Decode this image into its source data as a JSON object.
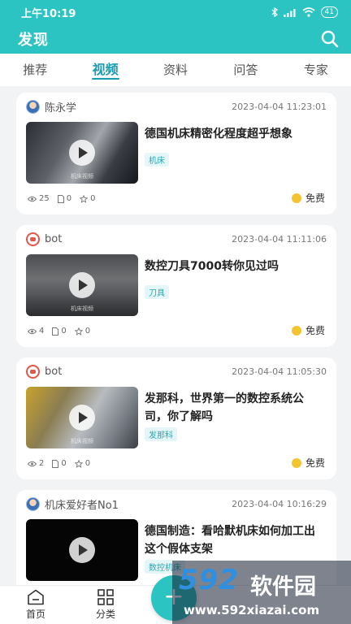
{
  "status": {
    "time": "上午10:19",
    "battery": "41"
  },
  "header": {
    "title": "发现"
  },
  "tabs": [
    {
      "label": "推荐"
    },
    {
      "label": "视频"
    },
    {
      "label": "资料"
    },
    {
      "label": "问答"
    },
    {
      "label": "专家"
    }
  ],
  "active_tab": "视频",
  "cards": [
    {
      "author": "陈永学",
      "time": "2023-04-04 11:23:01",
      "title": "德国机床精密化程度超乎想象",
      "tag": "机床",
      "views": "25",
      "docs": "0",
      "stars": "0",
      "price": "免费",
      "thumb_caption": "机床视频"
    },
    {
      "author": "bot",
      "time": "2023-04-04 11:11:06",
      "title": "数控刀具7000转你见过吗",
      "tag": "刀具",
      "views": "4",
      "docs": "0",
      "stars": "0",
      "price": "免费",
      "thumb_caption": "机床视频"
    },
    {
      "author": "bot",
      "time": "2023-04-04 11:05:30",
      "title": "发那科，世界第一的数控系统公司，你了解吗",
      "tag": "发那科",
      "views": "2",
      "docs": "0",
      "stars": "0",
      "price": "免费",
      "thumb_caption": "机床视频"
    },
    {
      "author": "机床爱好者No1",
      "time": "2023-04-04 10:16:29",
      "title": "德国制造：看哈默机床如何加工出这个假体支架",
      "tag": "数控机床"
    }
  ],
  "bottom_nav": {
    "home_label": "首页",
    "category_label": "分类",
    "fab_label": "+"
  },
  "watermark": {
    "brand": "592",
    "brand_cn": "软件园",
    "url": "www.592xiazai.com"
  },
  "colors": {
    "primary": "#2cc4c2",
    "tab_active": "#1a9bb0",
    "coin": "#f4c430"
  }
}
